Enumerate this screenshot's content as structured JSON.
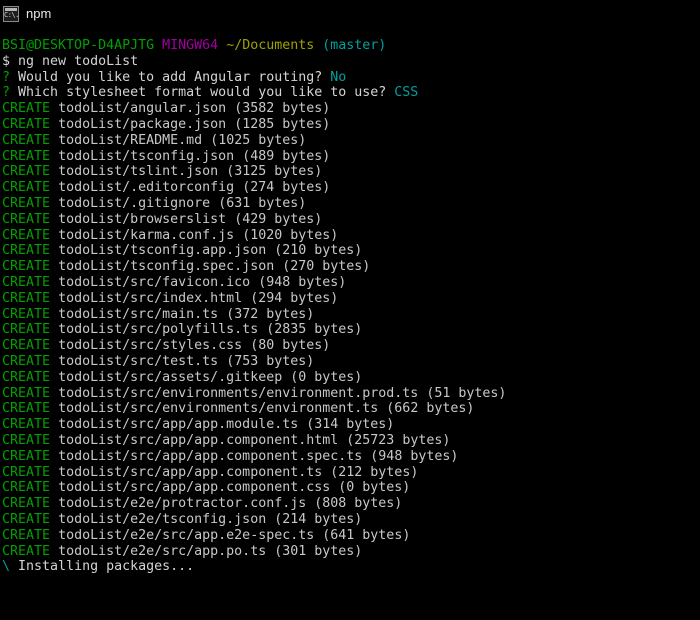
{
  "window": {
    "title": "npm",
    "icon": "console-icon",
    "icon_glyph": "C:\\."
  },
  "colors": {
    "background": "#000000",
    "foreground": "#cccccc",
    "green": "#00a000",
    "magenta": "#a000a0",
    "yellow": "#a0a000",
    "cyan": "#00a0a0"
  },
  "terminal": {
    "prompt": {
      "user_host": "BSI@DESKTOP-D4APJTG",
      "shell": "MINGW64",
      "path": "~/Documents",
      "branch": "(master)",
      "sigil": "$",
      "command": "ng new todoList"
    },
    "questions": [
      {
        "marker": "?",
        "text": "Would you like to add Angular routing?",
        "answer": "No"
      },
      {
        "marker": "?",
        "text": "Which stylesheet format would you like to use?",
        "answer": "CSS"
      }
    ],
    "create_label": "CREATE",
    "created_files": [
      {
        "path": "todoList/angular.json",
        "size": "(3582 bytes)"
      },
      {
        "path": "todoList/package.json",
        "size": "(1285 bytes)"
      },
      {
        "path": "todoList/README.md",
        "size": "(1025 bytes)"
      },
      {
        "path": "todoList/tsconfig.json",
        "size": "(489 bytes)"
      },
      {
        "path": "todoList/tslint.json",
        "size": "(3125 bytes)"
      },
      {
        "path": "todoList/.editorconfig",
        "size": "(274 bytes)"
      },
      {
        "path": "todoList/.gitignore",
        "size": "(631 bytes)"
      },
      {
        "path": "todoList/browserslist",
        "size": "(429 bytes)"
      },
      {
        "path": "todoList/karma.conf.js",
        "size": "(1020 bytes)"
      },
      {
        "path": "todoList/tsconfig.app.json",
        "size": "(210 bytes)"
      },
      {
        "path": "todoList/tsconfig.spec.json",
        "size": "(270 bytes)"
      },
      {
        "path": "todoList/src/favicon.ico",
        "size": "(948 bytes)"
      },
      {
        "path": "todoList/src/index.html",
        "size": "(294 bytes)"
      },
      {
        "path": "todoList/src/main.ts",
        "size": "(372 bytes)"
      },
      {
        "path": "todoList/src/polyfills.ts",
        "size": "(2835 bytes)"
      },
      {
        "path": "todoList/src/styles.css",
        "size": "(80 bytes)"
      },
      {
        "path": "todoList/src/test.ts",
        "size": "(753 bytes)"
      },
      {
        "path": "todoList/src/assets/.gitkeep",
        "size": "(0 bytes)"
      },
      {
        "path": "todoList/src/environments/environment.prod.ts",
        "size": "(51 bytes)"
      },
      {
        "path": "todoList/src/environments/environment.ts",
        "size": "(662 bytes)"
      },
      {
        "path": "todoList/src/app/app.module.ts",
        "size": "(314 bytes)"
      },
      {
        "path": "todoList/src/app/app.component.html",
        "size": "(25723 bytes)"
      },
      {
        "path": "todoList/src/app/app.component.spec.ts",
        "size": "(948 bytes)"
      },
      {
        "path": "todoList/src/app/app.component.ts",
        "size": "(212 bytes)"
      },
      {
        "path": "todoList/src/app/app.component.css",
        "size": "(0 bytes)"
      },
      {
        "path": "todoList/e2e/protractor.conf.js",
        "size": "(808 bytes)"
      },
      {
        "path": "todoList/e2e/tsconfig.json",
        "size": "(214 bytes)"
      },
      {
        "path": "todoList/e2e/src/app.e2e-spec.ts",
        "size": "(641 bytes)"
      },
      {
        "path": "todoList/e2e/src/app.po.ts",
        "size": "(301 bytes)"
      }
    ],
    "status": {
      "spinner": "\\",
      "text": "Installing packages..."
    }
  }
}
